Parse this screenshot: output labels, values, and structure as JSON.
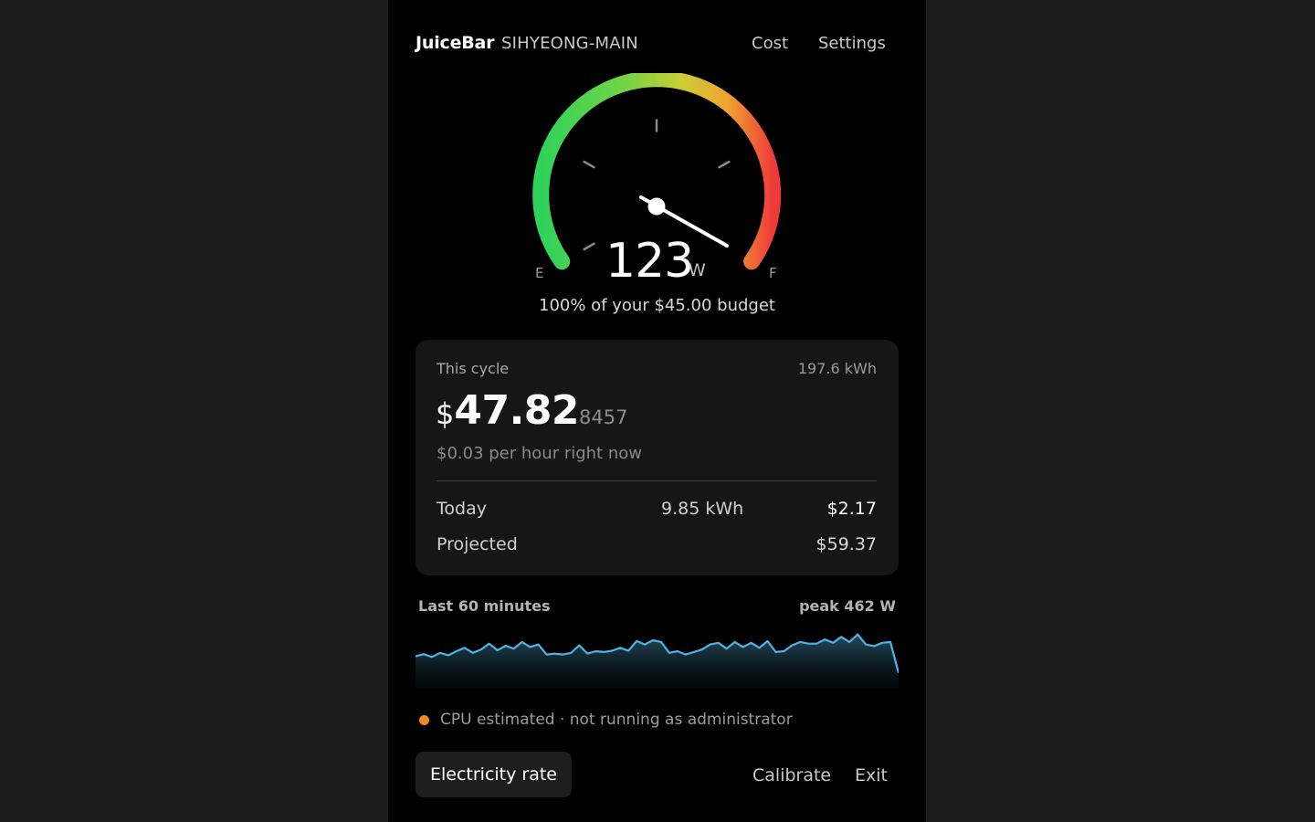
{
  "app": {
    "name": "JuiceBar",
    "device": "SIHYEONG-MAIN"
  },
  "nav": {
    "cost": "Cost",
    "settings": "Settings"
  },
  "gauge": {
    "value": "123",
    "unit": "W",
    "empty_label": "E",
    "full_label": "F",
    "level_fraction": 0.85,
    "gradient_colors": [
      "#2fd25a",
      "#8fd43a",
      "#f0c23a",
      "#f4832f",
      "#ee3a3a"
    ],
    "budget_text": "100% of your $45.00 budget"
  },
  "cycle": {
    "label": "This cycle",
    "kwh": "197.6 kWh",
    "currency": "$",
    "amount": "47.82",
    "amount_fraction": "8457",
    "rate_text": "$0.03 per hour right now",
    "rows": [
      {
        "label": "Today",
        "kwh": "9.85 kWh",
        "cost": "$2.17"
      },
      {
        "label": "Projected",
        "kwh": "",
        "cost": "$59.37"
      }
    ]
  },
  "history": {
    "label": "Last 60 minutes",
    "peak": "peak 462 W",
    "line_color": "#4fb3e6",
    "values": [
      400,
      405,
      398,
      408,
      402,
      412,
      420,
      408,
      416,
      430,
      414,
      425,
      418,
      434,
      422,
      428,
      404,
      406,
      404,
      408,
      426,
      406,
      412,
      410,
      413,
      420,
      413,
      436,
      428,
      438,
      434,
      408,
      412,
      404,
      410,
      416,
      428,
      432,
      418,
      434,
      422,
      432,
      420,
      436,
      410,
      412,
      426,
      434,
      430,
      430,
      440,
      432,
      446,
      434,
      452,
      428,
      424,
      432,
      434,
      360
    ]
  },
  "status": {
    "dot_color": "#f08a24",
    "text": "CPU estimated · not running as administrator"
  },
  "footer": {
    "rate_button": "Electricity rate",
    "calibrate": "Calibrate",
    "exit": "Exit"
  }
}
